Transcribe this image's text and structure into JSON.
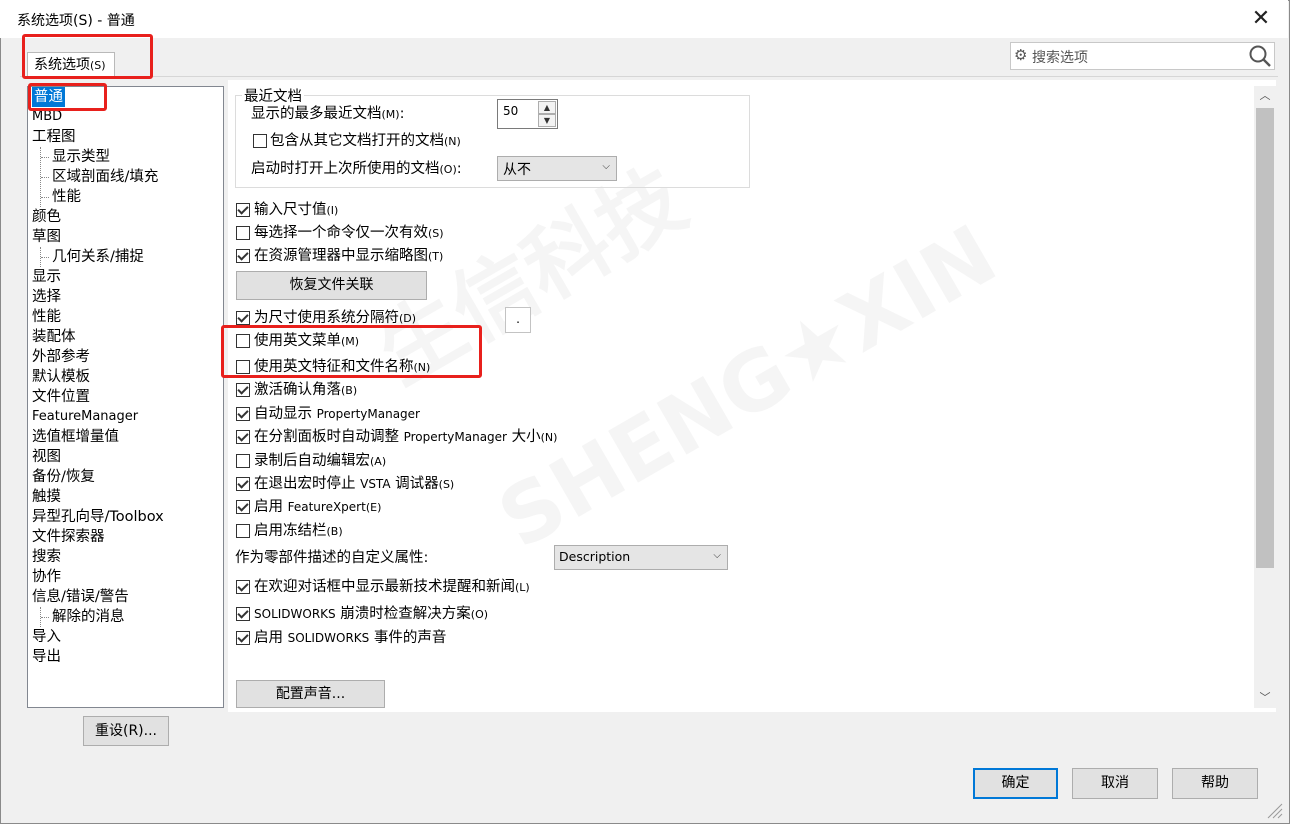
{
  "window": {
    "title": "系统选项(S) - 普通",
    "close_glyph": "✕"
  },
  "tab": {
    "label": "系统选项",
    "mnemonic": "(S)"
  },
  "search": {
    "placeholder": "搜索选项"
  },
  "tree": {
    "items": [
      {
        "label": "普通",
        "level": 0,
        "selected": true
      },
      {
        "label": "MBD",
        "level": 0
      },
      {
        "label": "工程图",
        "level": 0
      },
      {
        "label": "显示类型",
        "level": 1
      },
      {
        "label": "区域剖面线/填充",
        "level": 1
      },
      {
        "label": "性能",
        "level": 1
      },
      {
        "label": "颜色",
        "level": 0
      },
      {
        "label": "草图",
        "level": 0
      },
      {
        "label": "几何关系/捕捉",
        "level": 1
      },
      {
        "label": "显示",
        "level": 0
      },
      {
        "label": "选择",
        "level": 0
      },
      {
        "label": "性能",
        "level": 0
      },
      {
        "label": "装配体",
        "level": 0
      },
      {
        "label": "外部参考",
        "level": 0
      },
      {
        "label": "默认模板",
        "level": 0
      },
      {
        "label": "文件位置",
        "level": 0
      },
      {
        "label": "FeatureManager",
        "level": 0
      },
      {
        "label": "选值框增量值",
        "level": 0
      },
      {
        "label": "视图",
        "level": 0
      },
      {
        "label": "备份/恢复",
        "level": 0
      },
      {
        "label": "触摸",
        "level": 0
      },
      {
        "label": "异型孔向导/Toolbox",
        "level": 0
      },
      {
        "label": "文件探索器",
        "level": 0
      },
      {
        "label": "搜索",
        "level": 0
      },
      {
        "label": "协作",
        "level": 0
      },
      {
        "label": "信息/错误/警告",
        "level": 0
      },
      {
        "label": "解除的消息",
        "level": 1
      },
      {
        "label": "导入",
        "level": 0
      },
      {
        "label": "导出",
        "level": 0
      }
    ]
  },
  "reset_button": {
    "label": "重设(R)..."
  },
  "recent_docs": {
    "title": "最近文档",
    "max_label": "显示的最多最近文档",
    "max_mn": "(M)",
    "max_colon": ":",
    "max_value": "50",
    "include_label": "包含从其它文档打开的文档",
    "include_mn": "(N)",
    "include_checked": false,
    "open_last_label": "启动时打开上次所使用的文档",
    "open_last_mn": "(O)",
    "open_last_colon": ":",
    "open_last_value": "从不"
  },
  "options": [
    {
      "label": "输入尺寸值",
      "mn": "(I)",
      "checked": true
    },
    {
      "label": "每选择一个命令仅一次有效",
      "mn": "(S)",
      "checked": false
    },
    {
      "label": "在资源管理器中显示缩略图",
      "mn": "(T)",
      "checked": true
    }
  ],
  "restore_assoc_button": {
    "label": "恢复文件关联"
  },
  "options2": [
    {
      "label": "为尺寸使用系统分隔符",
      "mn": "(D)",
      "checked": true
    },
    {
      "label": "使用英文菜单",
      "mn": "(M)",
      "checked": false
    },
    {
      "label": "使用英文特征和文件名称",
      "mn": "(N)",
      "checked": false
    },
    {
      "label": "激活确认角落",
      "mn": "(B)",
      "checked": true
    },
    {
      "label": "自动显示 ",
      "lat": "PropertyManager",
      "mn": "",
      "checked": true
    },
    {
      "label": "在分割面板时自动调整 ",
      "lat": "PropertyManager",
      "tail": " 大小",
      "mn": "(N)",
      "checked": true
    },
    {
      "label": "录制后自动编辑宏",
      "mn": "(A)",
      "checked": false
    },
    {
      "label": "在退出宏时停止 ",
      "lat": "VSTA",
      "tail": " 调试器",
      "mn": "(S)",
      "checked": true
    },
    {
      "label": "启用 ",
      "lat": "FeatureXpert",
      "mn": "(E)",
      "checked": true
    },
    {
      "label": "启用冻结栏",
      "mn": "(B)",
      "checked": false
    }
  ],
  "separator_value": ".",
  "custom_prop": {
    "label": "作为零部件描述的自定义属性",
    "colon": ":",
    "value": "Description"
  },
  "options3": [
    {
      "label": "在欢迎对话框中显示最新技术提醒和新闻",
      "mn": "(L)",
      "checked": true
    },
    {
      "lat": "SOLIDWORKS",
      "label": " 崩溃时检查解决方案",
      "mn": "(O)",
      "checked": true
    },
    {
      "label": "启用 ",
      "lat": "SOLIDWORKS",
      "tail": " 事件的声音",
      "mn": "",
      "checked": true
    }
  ],
  "config_sound_button": {
    "label": "配置声音..."
  },
  "footer": {
    "ok": "确定",
    "cancel": "取消",
    "help": "帮助"
  },
  "watermark": {
    "line1": "生信科技",
    "line2": "SHENG★XIN"
  },
  "colors": {
    "accent": "#0078d7",
    "highlight_box": "#e8201c",
    "selected_bg": "#0078d7"
  }
}
